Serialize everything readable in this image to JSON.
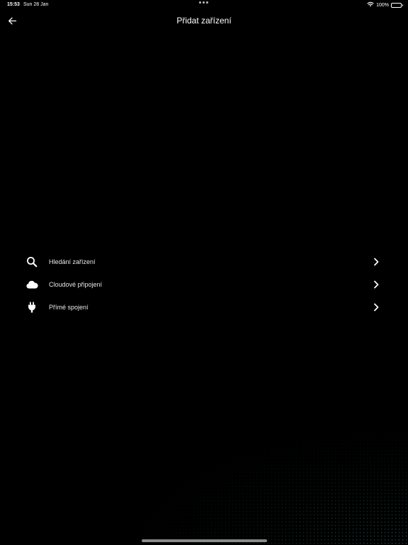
{
  "status_bar": {
    "time": "15:53",
    "date": "Sun 28 Jan",
    "battery_percent": "100%",
    "battery_level": 1.0,
    "icons": [
      "wifi-icon",
      "battery-icon"
    ]
  },
  "header": {
    "back_icon": "arrow-left-icon",
    "title": "Přidat zařízení"
  },
  "menu": {
    "items": [
      {
        "label": "Hledání zařízení",
        "icon": "search-icon"
      },
      {
        "label": "Cloudové připojení",
        "icon": "cloud-icon"
      },
      {
        "label": "Přímé spojení",
        "icon": "plug-icon"
      }
    ],
    "chevron_icon": "chevron-right-icon"
  },
  "colors": {
    "background": "#000000",
    "text": "#ffffff",
    "accent_glow": "#288c78"
  }
}
